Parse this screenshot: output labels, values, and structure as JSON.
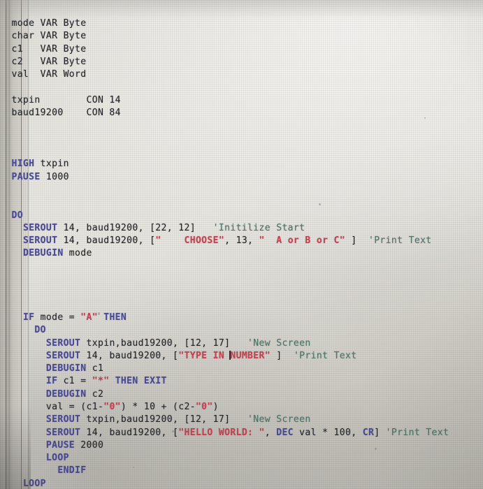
{
  "editor": {
    "app_kind": "pbasic-code-editor",
    "colors": {
      "keyword": "#4a4a9e",
      "string": "#cf4150",
      "comment": "#4d7a6a",
      "plain": "#1d1d1f",
      "background": "#e7e5df",
      "gutter": "#bfbcb6"
    },
    "caret": {
      "present": true,
      "line_index": 19,
      "before_text": "NUMBER"
    }
  },
  "code": {
    "lines": [
      {
        "indent": 0,
        "tokens": [
          {
            "t": "mode VAR Byte",
            "c": "pl"
          }
        ]
      },
      {
        "indent": 0,
        "tokens": [
          {
            "t": "char VAR Byte",
            "c": "pl"
          }
        ]
      },
      {
        "indent": 0,
        "tokens": [
          {
            "t": "c1   VAR Byte",
            "c": "pl"
          }
        ]
      },
      {
        "indent": 0,
        "tokens": [
          {
            "t": "c2   VAR Byte",
            "c": "pl"
          }
        ]
      },
      {
        "indent": 0,
        "tokens": [
          {
            "t": "val  VAR Word",
            "c": "pl"
          }
        ]
      },
      {
        "indent": 0,
        "tokens": []
      },
      {
        "indent": 0,
        "tokens": [
          {
            "t": "txpin        CON 14",
            "c": "pl"
          }
        ]
      },
      {
        "indent": 0,
        "tokens": [
          {
            "t": "baud19200    CON 84",
            "c": "pl"
          }
        ]
      },
      {
        "indent": 0,
        "tokens": []
      },
      {
        "indent": 0,
        "tokens": []
      },
      {
        "indent": 0,
        "tokens": []
      },
      {
        "indent": 0,
        "tokens": [
          {
            "t": "HIGH",
            "c": "kw"
          },
          {
            "t": " txpin",
            "c": "pl"
          }
        ]
      },
      {
        "indent": 0,
        "tokens": [
          {
            "t": "PAUSE",
            "c": "kw"
          },
          {
            "t": " 1000",
            "c": "pl"
          }
        ]
      },
      {
        "indent": 0,
        "tokens": []
      },
      {
        "indent": 0,
        "tokens": []
      },
      {
        "indent": 0,
        "tokens": [
          {
            "t": "DO",
            "c": "kw"
          }
        ]
      },
      {
        "indent": 1,
        "tokens": [
          {
            "t": "SEROUT",
            "c": "kw"
          },
          {
            "t": " 14, baud19200, [22, 12]   ",
            "c": "pl"
          },
          {
            "t": "'Initilize Start",
            "c": "rem"
          }
        ]
      },
      {
        "indent": 1,
        "tokens": [
          {
            "t": "SEROUT",
            "c": "kw"
          },
          {
            "t": " 14, baud19200, [",
            "c": "pl"
          },
          {
            "t": "\"    CHOOSE\"",
            "c": "str"
          },
          {
            "t": ", 13, ",
            "c": "pl"
          },
          {
            "t": "\"  A or B or C\"",
            "c": "str"
          },
          {
            "t": " ]  ",
            "c": "pl"
          },
          {
            "t": "'Print Text",
            "c": "rem"
          }
        ]
      },
      {
        "indent": 1,
        "tokens": [
          {
            "t": "DEBUGIN",
            "c": "kw"
          },
          {
            "t": " mode",
            "c": "pl"
          }
        ]
      },
      {
        "indent": 0,
        "tokens": []
      },
      {
        "indent": 0,
        "tokens": []
      },
      {
        "indent": 0,
        "tokens": []
      },
      {
        "indent": 0,
        "tokens": []
      },
      {
        "indent": 1,
        "tokens": [
          {
            "t": "IF",
            "c": "kw"
          },
          {
            "t": " mode = ",
            "c": "pl"
          },
          {
            "t": "\"A\"",
            "c": "str"
          },
          {
            "t": " ",
            "c": "pl"
          },
          {
            "t": "THEN",
            "c": "kw"
          }
        ]
      },
      {
        "indent": 2,
        "tokens": [
          {
            "t": "DO",
            "c": "kw"
          }
        ]
      },
      {
        "indent": 3,
        "tokens": [
          {
            "t": "SEROUT",
            "c": "kw"
          },
          {
            "t": " txpin,baud19200, [12, 17]   ",
            "c": "pl"
          },
          {
            "t": "'New Screen",
            "c": "rem"
          }
        ]
      },
      {
        "indent": 3,
        "tokens": [
          {
            "t": "SEROUT",
            "c": "kw"
          },
          {
            "t": " 14, baud19200, [",
            "c": "pl"
          },
          {
            "t": "\"TYPE IN ",
            "c": "str"
          },
          {
            "t": "CARET",
            "c": "caret"
          },
          {
            "t": "NUMBER\"",
            "c": "str"
          },
          {
            "t": " ]  ",
            "c": "pl"
          },
          {
            "t": "'Print Text",
            "c": "rem"
          }
        ]
      },
      {
        "indent": 3,
        "tokens": [
          {
            "t": "DEBUGIN",
            "c": "kw"
          },
          {
            "t": " c1",
            "c": "pl"
          }
        ]
      },
      {
        "indent": 3,
        "tokens": [
          {
            "t": "IF",
            "c": "kw"
          },
          {
            "t": " c1 = ",
            "c": "pl"
          },
          {
            "t": "\"*\"",
            "c": "str"
          },
          {
            "t": " ",
            "c": "pl"
          },
          {
            "t": "THEN EXIT",
            "c": "kw"
          }
        ]
      },
      {
        "indent": 3,
        "tokens": [
          {
            "t": "DEBUGIN",
            "c": "kw"
          },
          {
            "t": " c2",
            "c": "pl"
          }
        ]
      },
      {
        "indent": 3,
        "tokens": [
          {
            "t": "val = (c1-",
            "c": "pl"
          },
          {
            "t": "\"0\"",
            "c": "str"
          },
          {
            "t": ") * 10 + (c2-",
            "c": "pl"
          },
          {
            "t": "\"0\"",
            "c": "str"
          },
          {
            "t": ")",
            "c": "pl"
          }
        ]
      },
      {
        "indent": 3,
        "tokens": [
          {
            "t": "SEROUT",
            "c": "kw"
          },
          {
            "t": " txpin,baud19200, [12, 17]   ",
            "c": "pl"
          },
          {
            "t": "'New Screen",
            "c": "rem"
          }
        ]
      },
      {
        "indent": 3,
        "tokens": [
          {
            "t": "SEROUT",
            "c": "kw"
          },
          {
            "t": " 14, baud19200, [",
            "c": "pl"
          },
          {
            "t": "\"HELLO WORLD: \"",
            "c": "str"
          },
          {
            "t": ", ",
            "c": "pl"
          },
          {
            "t": "DEC",
            "c": "kw"
          },
          {
            "t": " val * 100, ",
            "c": "pl"
          },
          {
            "t": "CR",
            "c": "kw"
          },
          {
            "t": "] ",
            "c": "pl"
          },
          {
            "t": "'Print Text",
            "c": "rem"
          }
        ]
      },
      {
        "indent": 3,
        "tokens": [
          {
            "t": "PAUSE",
            "c": "kw"
          },
          {
            "t": " 2000",
            "c": "pl"
          }
        ]
      },
      {
        "indent": 3,
        "tokens": [
          {
            "t": "LOOP",
            "c": "kw"
          }
        ]
      },
      {
        "indent": 4,
        "tokens": [
          {
            "t": "ENDIF",
            "c": "kw"
          }
        ]
      },
      {
        "indent": 1,
        "tokens": [
          {
            "t": "LOOP",
            "c": "kw"
          }
        ]
      }
    ]
  }
}
